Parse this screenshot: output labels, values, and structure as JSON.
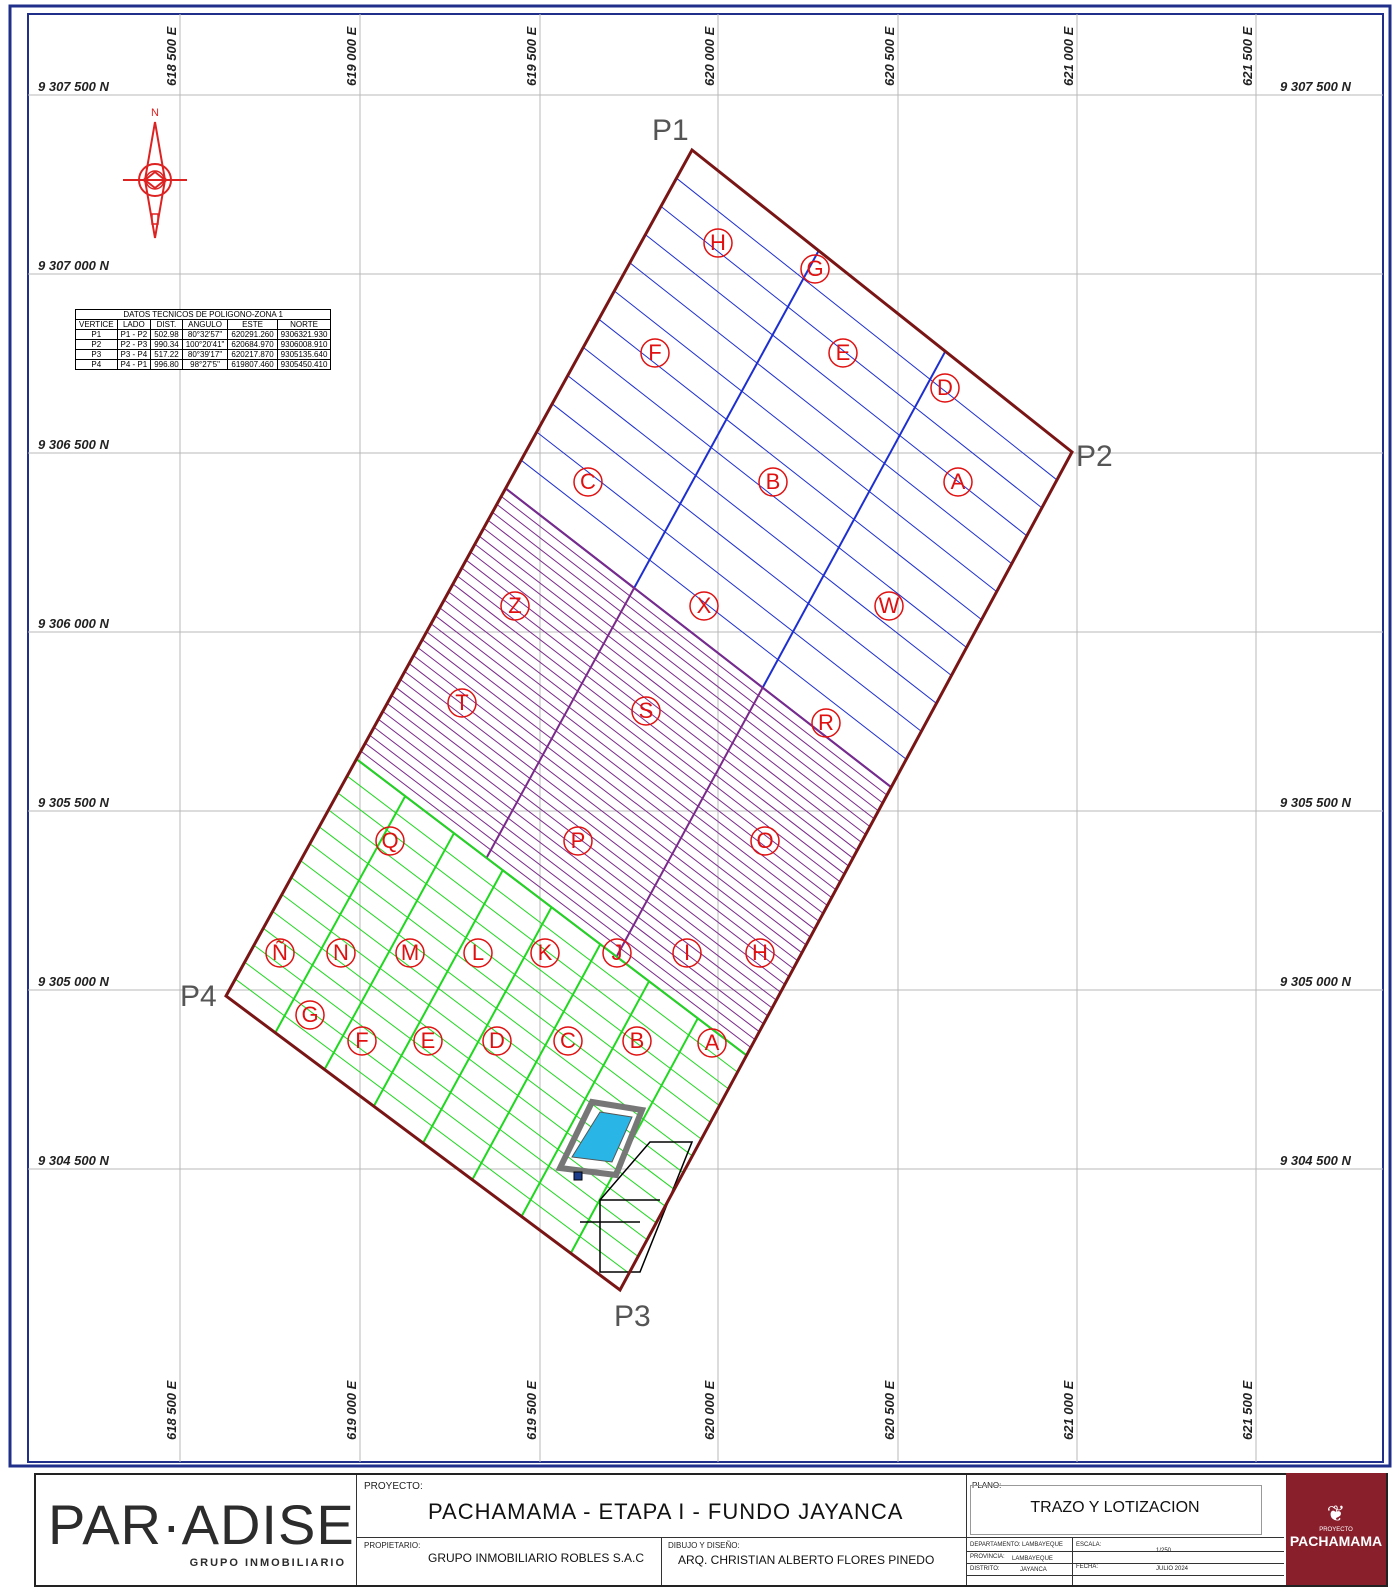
{
  "plan": {
    "easting_labels": [
      "618 500 E",
      "619 000 E",
      "619 500 E",
      "620 000 E",
      "620 500 E",
      "621 000 E",
      "621 500 E"
    ],
    "northing_labels": [
      "9 307 500 N",
      "9 307 000 N",
      "9 306 500 N",
      "9 306 000 N",
      "9 305 500 N",
      "9 305 000 N",
      "9 304 500 N"
    ],
    "north_label": "N",
    "vertex_labels": [
      "P1",
      "P2",
      "P3",
      "P4"
    ],
    "zone_blue_blocks": [
      "H",
      "G",
      "F",
      "E",
      "D",
      "C",
      "B",
      "A"
    ],
    "zone_purple_blocks": [
      "Z",
      "X",
      "W",
      "T",
      "S",
      "R",
      "Q",
      "P",
      "O"
    ],
    "zone_green_blocks_row1": [
      "Ñ",
      "N",
      "M",
      "L",
      "K",
      "J",
      "I",
      "H"
    ],
    "zone_green_blocks_row2": [
      "G",
      "F",
      "E",
      "D",
      "C",
      "B",
      "A"
    ],
    "colors": {
      "frame": "#1f2f8a",
      "boundary": "#7a1515",
      "blue_zone": "#1e2fd0",
      "purple_zone": "#7a2a8a",
      "green_zone": "#1fd81f",
      "block_marker": "#e01010",
      "pool": "#29b6e6"
    }
  },
  "table": {
    "title": "DATOS TECNICOS DE POLIGONO-ZONA 1",
    "headers": [
      "VERTICE",
      "LADO",
      "DIST.",
      "ANGULO",
      "ESTE",
      "NORTE"
    ],
    "rows": [
      [
        "P1",
        "P1 - P2",
        "502.98",
        "80°32'57\"",
        "620291.260",
        "9306321.930"
      ],
      [
        "P2",
        "P2 - P3",
        "990.34",
        "100°20'41\"",
        "620684.970",
        "9306008.910"
      ],
      [
        "P3",
        "P3 - P4",
        "517.22",
        "80°39'17\"",
        "620217.870",
        "9305135.640"
      ],
      [
        "P4",
        "P4 - P1",
        "996.80",
        "98°27'5\"",
        "619807.460",
        "9305450.410"
      ]
    ]
  },
  "titleblock": {
    "logo": "PAR·ADISE",
    "logo_sub": "GRUPO INMOBILIARIO",
    "proyecto_label": "PROYECTO:",
    "proyecto": "PACHAMAMA - ETAPA I - FUNDO JAYANCA",
    "propietario_label": "PROPIETARIO:",
    "propietario": "GRUPO INMOBILIARIO ROBLES S.A.C",
    "dibujo_label": "DIBUJO Y DISEÑO:",
    "dibujo": "ARQ. CHRISTIAN ALBERTO FLORES PINEDO",
    "plano_label": "PLANO:",
    "plano": "TRAZO Y LOTIZACION",
    "departamento_label": "DEPARTAMENTO:",
    "departamento": "LAMBAYEQUE",
    "provincia_label": "PROVINCIA:",
    "provincia": "LAMBAYEQUE",
    "distrito_label": "DISTRITO:",
    "distrito": "JAYANCA",
    "escala_label": "ESCALA:",
    "escala": "1/250",
    "fecha_label": "FECHA:",
    "fecha": "JULIO 2024",
    "badge_small": "PROYECTO",
    "badge_name": "PACHAMAMA"
  }
}
